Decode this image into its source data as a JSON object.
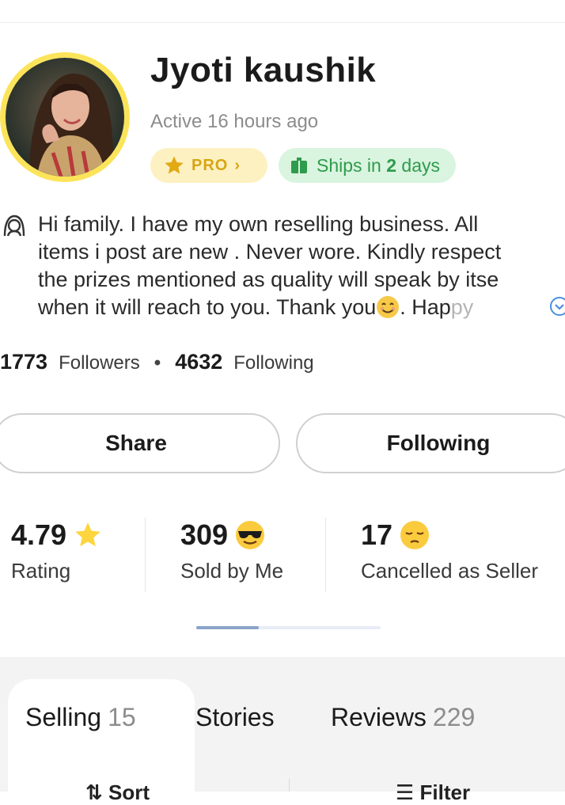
{
  "profile": {
    "name": "Jyoti kaushik",
    "active_status": "Active 16 hours ago",
    "pro_label": "PRO",
    "pro_chevron": "›",
    "ships_prefix": "Ships in ",
    "ships_bold": "2",
    "ships_suffix": " days",
    "bio_lines": [
      "Hi family. I have my own reselling business. All",
      "items i post are new . Never wore. Kindly respect",
      "the prizes mentioned as quality will speak by itse",
      "when it will reach to you. Thank you"
    ],
    "bio_line4_after_emoji": ". Hap",
    "bio_faded": "py"
  },
  "counts": {
    "followers_value": "1773",
    "followers_label": "Followers",
    "separator": "•",
    "following_value": "4632",
    "following_label": "Following"
  },
  "actions": {
    "share_label": "Share",
    "following_label": "Following"
  },
  "stats": [
    {
      "value": "4.79",
      "label": "Rating",
      "icon": "star-icon"
    },
    {
      "value": "309",
      "label": "Sold by Me",
      "icon": "sunglasses-emoji-icon"
    },
    {
      "value": "17",
      "label": "Cancelled as Seller",
      "icon": "pensive-emoji-icon"
    }
  ],
  "carousel": {
    "page_fraction": 0.34
  },
  "tabs": [
    {
      "label": "Selling",
      "count": "15",
      "active": true
    },
    {
      "label": "Stories",
      "count": ""
    },
    {
      "label": "Reviews",
      "count": "229"
    }
  ],
  "toolbar": {
    "sort_label": "Sort",
    "filter_label": "Filter"
  },
  "colors": {
    "avatar_ring": "#fbe45a",
    "pro_bg": "#fdf1c2",
    "pro_text": "#d7a514",
    "ship_bg": "#d9f4df",
    "ship_text": "#2f9b4c",
    "indicator": "#8aa3c9"
  }
}
